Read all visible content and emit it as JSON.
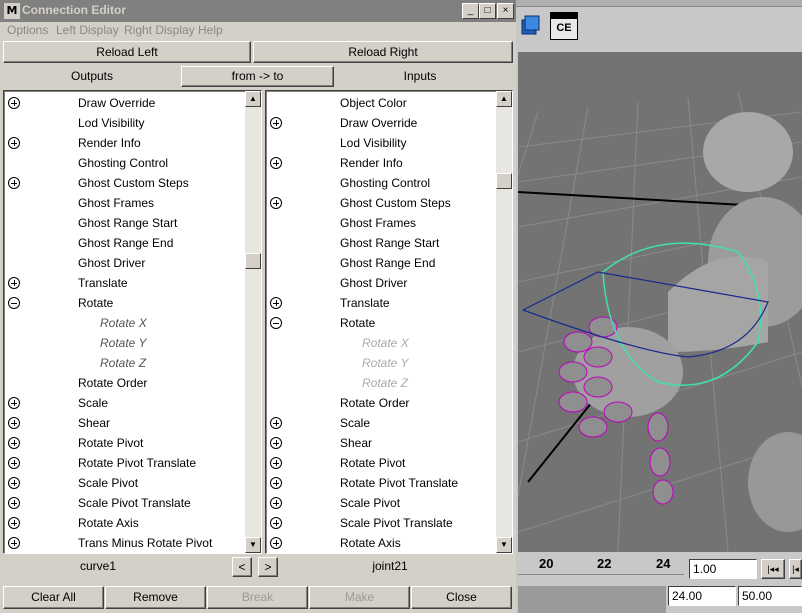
{
  "window": {
    "title": "Connection Editor",
    "min": "_",
    "max": "□",
    "close": "×",
    "icon_letter": "M"
  },
  "menu": [
    "Options",
    "Left Display",
    "Right Display",
    "Help"
  ],
  "reload_left": "Reload Left",
  "reload_right": "Reload Right",
  "outputs_label": "Outputs",
  "direction_button": "from -> to",
  "inputs_label": "Inputs",
  "left_list": [
    {
      "label": "Draw Override",
      "expander": "plus"
    },
    {
      "label": "Lod Visibility",
      "expander": ""
    },
    {
      "label": "Render Info",
      "expander": "plus"
    },
    {
      "label": "Ghosting Control",
      "expander": ""
    },
    {
      "label": "Ghost Custom Steps",
      "expander": "plus"
    },
    {
      "label": "Ghost Frames",
      "expander": ""
    },
    {
      "label": "Ghost Range Start",
      "expander": ""
    },
    {
      "label": "Ghost Range End",
      "expander": ""
    },
    {
      "label": "Ghost Driver",
      "expander": ""
    },
    {
      "label": "Translate",
      "expander": "plus"
    },
    {
      "label": "Rotate",
      "expander": "minus"
    },
    {
      "label": "Rotate X",
      "expander": "",
      "sub": true
    },
    {
      "label": "Rotate Y",
      "expander": "",
      "sub": true
    },
    {
      "label": "Rotate Z",
      "expander": "",
      "sub": true
    },
    {
      "label": "Rotate Order",
      "expander": ""
    },
    {
      "label": "Scale",
      "expander": "plus"
    },
    {
      "label": "Shear",
      "expander": "plus"
    },
    {
      "label": "Rotate Pivot",
      "expander": "plus"
    },
    {
      "label": "Rotate Pivot Translate",
      "expander": "plus"
    },
    {
      "label": "Scale Pivot",
      "expander": "plus"
    },
    {
      "label": "Scale Pivot Translate",
      "expander": "plus"
    },
    {
      "label": "Rotate Axis",
      "expander": "plus"
    },
    {
      "label": "Trans Minus Rotate Pivot",
      "expander": "plus"
    }
  ],
  "right_list": [
    {
      "label": "Object Color",
      "expander": ""
    },
    {
      "label": "Draw Override",
      "expander": "plus"
    },
    {
      "label": "Lod Visibility",
      "expander": ""
    },
    {
      "label": "Render Info",
      "expander": "plus"
    },
    {
      "label": "Ghosting Control",
      "expander": ""
    },
    {
      "label": "Ghost Custom Steps",
      "expander": "plus"
    },
    {
      "label": "Ghost Frames",
      "expander": ""
    },
    {
      "label": "Ghost Range Start",
      "expander": ""
    },
    {
      "label": "Ghost Range End",
      "expander": ""
    },
    {
      "label": "Ghost Driver",
      "expander": ""
    },
    {
      "label": "Translate",
      "expander": "plus"
    },
    {
      "label": "Rotate",
      "expander": "minus"
    },
    {
      "label": "Rotate X",
      "expander": "",
      "sub": true,
      "dim": true
    },
    {
      "label": "Rotate Y",
      "expander": "",
      "sub": true,
      "dim": true
    },
    {
      "label": "Rotate Z",
      "expander": "",
      "sub": true,
      "dim": true
    },
    {
      "label": "Rotate Order",
      "expander": ""
    },
    {
      "label": "Scale",
      "expander": "plus"
    },
    {
      "label": "Shear",
      "expander": "plus"
    },
    {
      "label": "Rotate Pivot",
      "expander": "plus"
    },
    {
      "label": "Rotate Pivot Translate",
      "expander": "plus"
    },
    {
      "label": "Scale Pivot",
      "expander": "plus"
    },
    {
      "label": "Scale Pivot Translate",
      "expander": "plus"
    },
    {
      "label": "Rotate Axis",
      "expander": "plus"
    }
  ],
  "left_node": "curve1",
  "right_node": "joint21",
  "nav_prev": "<",
  "nav_next": ">",
  "buttons": {
    "clear_all": "Clear All",
    "remove": "Remove",
    "break": "Break",
    "make": "Make",
    "close": "Close"
  },
  "maya": {
    "shelf_icon_label": "CE",
    "timeline_ticks": [
      "20",
      "22",
      "24"
    ],
    "current_time": "1.00",
    "range_end": "24.00",
    "range_max": "50.00",
    "playback_icon": "step-back-key-icon"
  }
}
